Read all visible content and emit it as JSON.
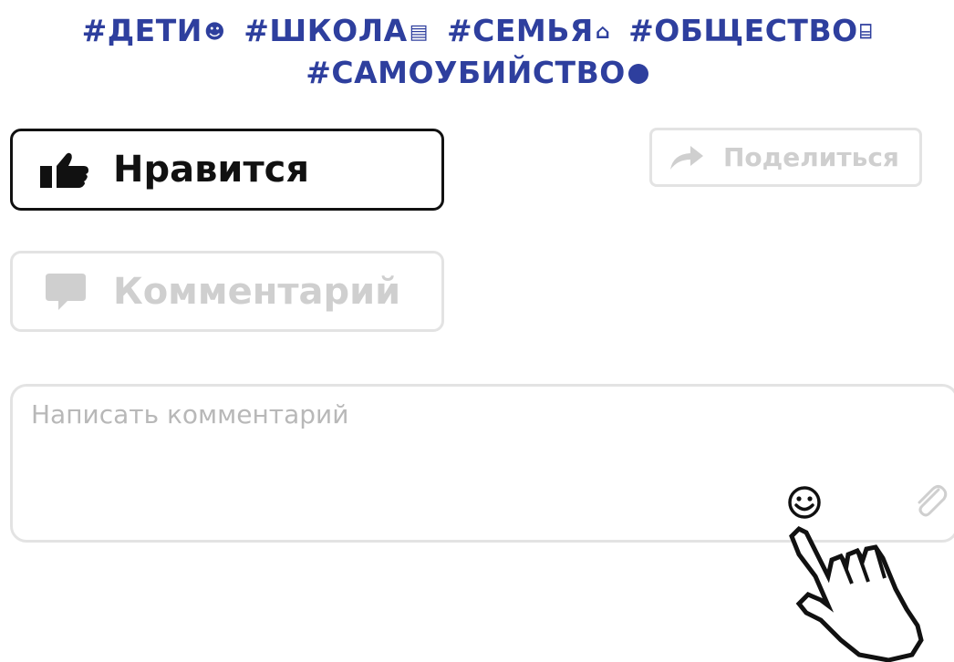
{
  "hashtags": {
    "line1": [
      {
        "text": "#ДЕТИ",
        "glyph": "☻",
        "icon": "smiley-icon"
      },
      {
        "text": "#ШКОЛА",
        "glyph": "▤",
        "icon": "notebook-icon"
      },
      {
        "text": "#СЕМЬЯ",
        "glyph": "⌂",
        "icon": "house-icon"
      },
      {
        "text": "#ОБЩЕСТВО",
        "glyph": "⌸",
        "icon": "factory-icon"
      }
    ],
    "line2": [
      {
        "text": "#САМОУБИЙСТВО",
        "icon": "black-dot-icon"
      }
    ]
  },
  "actions": {
    "like_label": "Нравится",
    "comment_label": "Комментарий",
    "share_label": "Поделиться"
  },
  "comment_input": {
    "placeholder": "Написать комментарий",
    "value": ""
  },
  "colors": {
    "hashtag": "#2e3f9e",
    "active_border": "#111111",
    "inactive_border": "#e3e3e3",
    "inactive_text": "#cfcfcf",
    "placeholder": "#b8b8b8"
  }
}
